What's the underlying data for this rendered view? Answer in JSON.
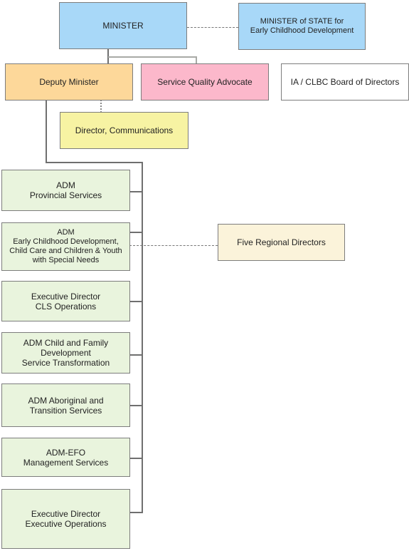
{
  "colors": {
    "minister": "#a8d8f8",
    "deputy": "#fdd89a",
    "advocate": "#fcb8cb",
    "board": "#ffffff",
    "communications": "#f7f3a3",
    "regional": "#fbf3da",
    "adm": "#e9f4dd"
  },
  "top": {
    "minister": "MINISTER",
    "minister_of_state": "MINISTER of STATE for\nEarly Childhood Development",
    "deputy_minister": "Deputy Minister",
    "service_quality_advocate": "Service Quality Advocate",
    "board": "IA / CLBC Board of Directors",
    "director_communications": "Director, Communications",
    "five_regional_directors": "Five Regional Directors"
  },
  "divisions": [
    {
      "label": "ADM\nProvincial Services"
    },
    {
      "label": "ADM\nEarly Childhood Development,\nChild Care and Children & Youth\nwith Special Needs"
    },
    {
      "label": "Executive Director\nCLS Operations"
    },
    {
      "label": "ADM Child and Family\nDevelopment\nService Transformation"
    },
    {
      "label": "ADM Aboriginal and\nTransition Services"
    },
    {
      "label": "ADM-EFO\nManagement Services"
    },
    {
      "label": "Executive Director\nExecutive Operations"
    }
  ]
}
